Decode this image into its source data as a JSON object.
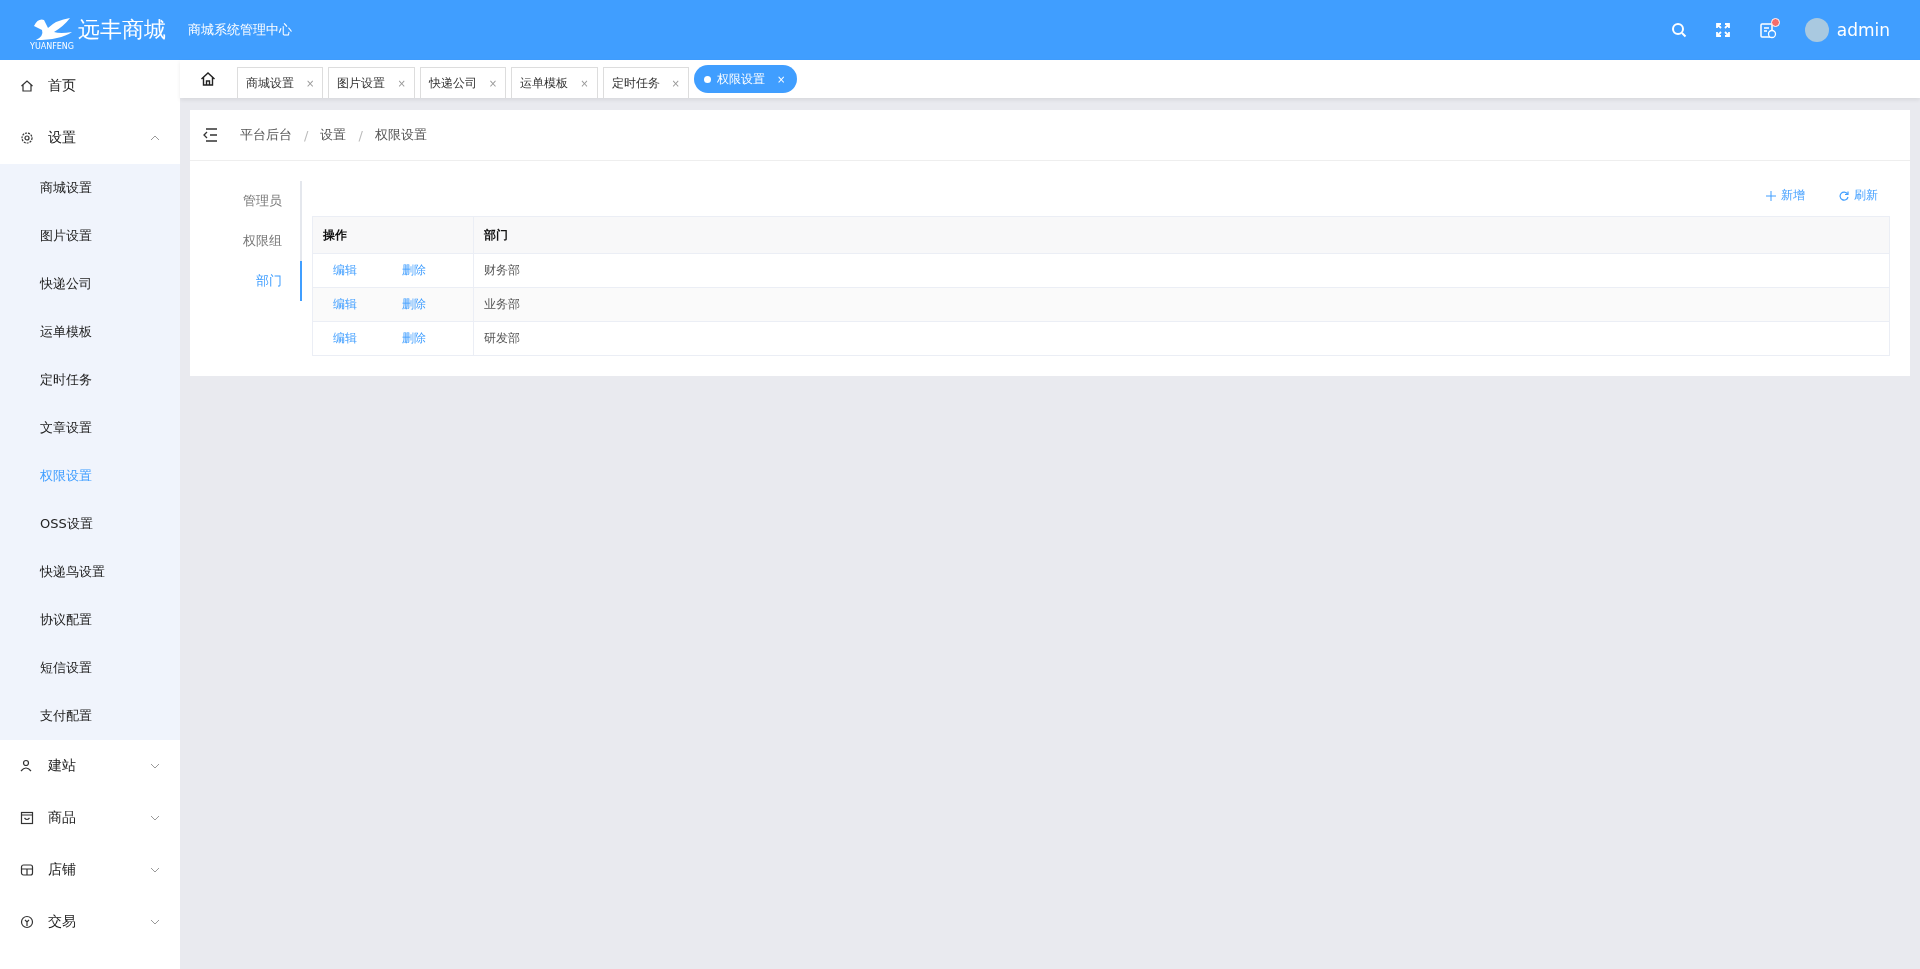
{
  "header": {
    "brand": "远丰商城",
    "brand_sub": "YUANFENG",
    "subtitle": "商城系统管理中心",
    "user": "admin",
    "notification": true
  },
  "sidebar": {
    "items": [
      {
        "label": "首页"
      },
      {
        "label": "设置",
        "expanded": true,
        "children": [
          {
            "label": "商城设置",
            "selected": false
          },
          {
            "label": "图片设置",
            "selected": false
          },
          {
            "label": "快递公司",
            "selected": false
          },
          {
            "label": "运单模板",
            "selected": false
          },
          {
            "label": "定时任务",
            "selected": false
          },
          {
            "label": "文章设置",
            "selected": false
          },
          {
            "label": "权限设置",
            "selected": true
          },
          {
            "label": "OSS设置",
            "selected": false
          },
          {
            "label": "快递鸟设置",
            "selected": false
          },
          {
            "label": "协议配置",
            "selected": false
          },
          {
            "label": "短信设置",
            "selected": false
          },
          {
            "label": "支付配置",
            "selected": false
          }
        ]
      },
      {
        "label": "建站",
        "expanded": false
      },
      {
        "label": "商品",
        "expanded": false
      },
      {
        "label": "店铺",
        "expanded": false
      },
      {
        "label": "交易",
        "expanded": false
      }
    ]
  },
  "tabs": [
    {
      "label": "商城设置",
      "close": "×",
      "selected": false
    },
    {
      "label": "图片设置",
      "close": "×",
      "selected": false
    },
    {
      "label": "快递公司",
      "close": "×",
      "selected": false
    },
    {
      "label": "运单模板",
      "close": "×",
      "selected": false
    },
    {
      "label": "定时任务",
      "close": "×",
      "selected": false
    },
    {
      "label": "权限设置",
      "close": "×",
      "selected": true
    }
  ],
  "breadcrumb": [
    {
      "label": "平台后台"
    },
    {
      "separator": "/",
      "label": "设置"
    },
    {
      "separator": "/",
      "label": "权限设置"
    }
  ],
  "side_tabs": [
    {
      "label": "管理员",
      "selected": false
    },
    {
      "label": "权限组",
      "selected": false
    },
    {
      "label": "部门",
      "selected": true
    }
  ],
  "toolbar": [
    "新增",
    "刷新"
  ],
  "table": {
    "columns": [
      "操作",
      "部门"
    ],
    "rows": [
      {
        "actions": [
          "编辑",
          "删除"
        ],
        "department": "财务部"
      },
      {
        "actions": [
          "编辑",
          "删除"
        ],
        "department": "业务部"
      },
      {
        "actions": [
          "编辑",
          "删除"
        ],
        "department": "研发部"
      }
    ]
  }
}
